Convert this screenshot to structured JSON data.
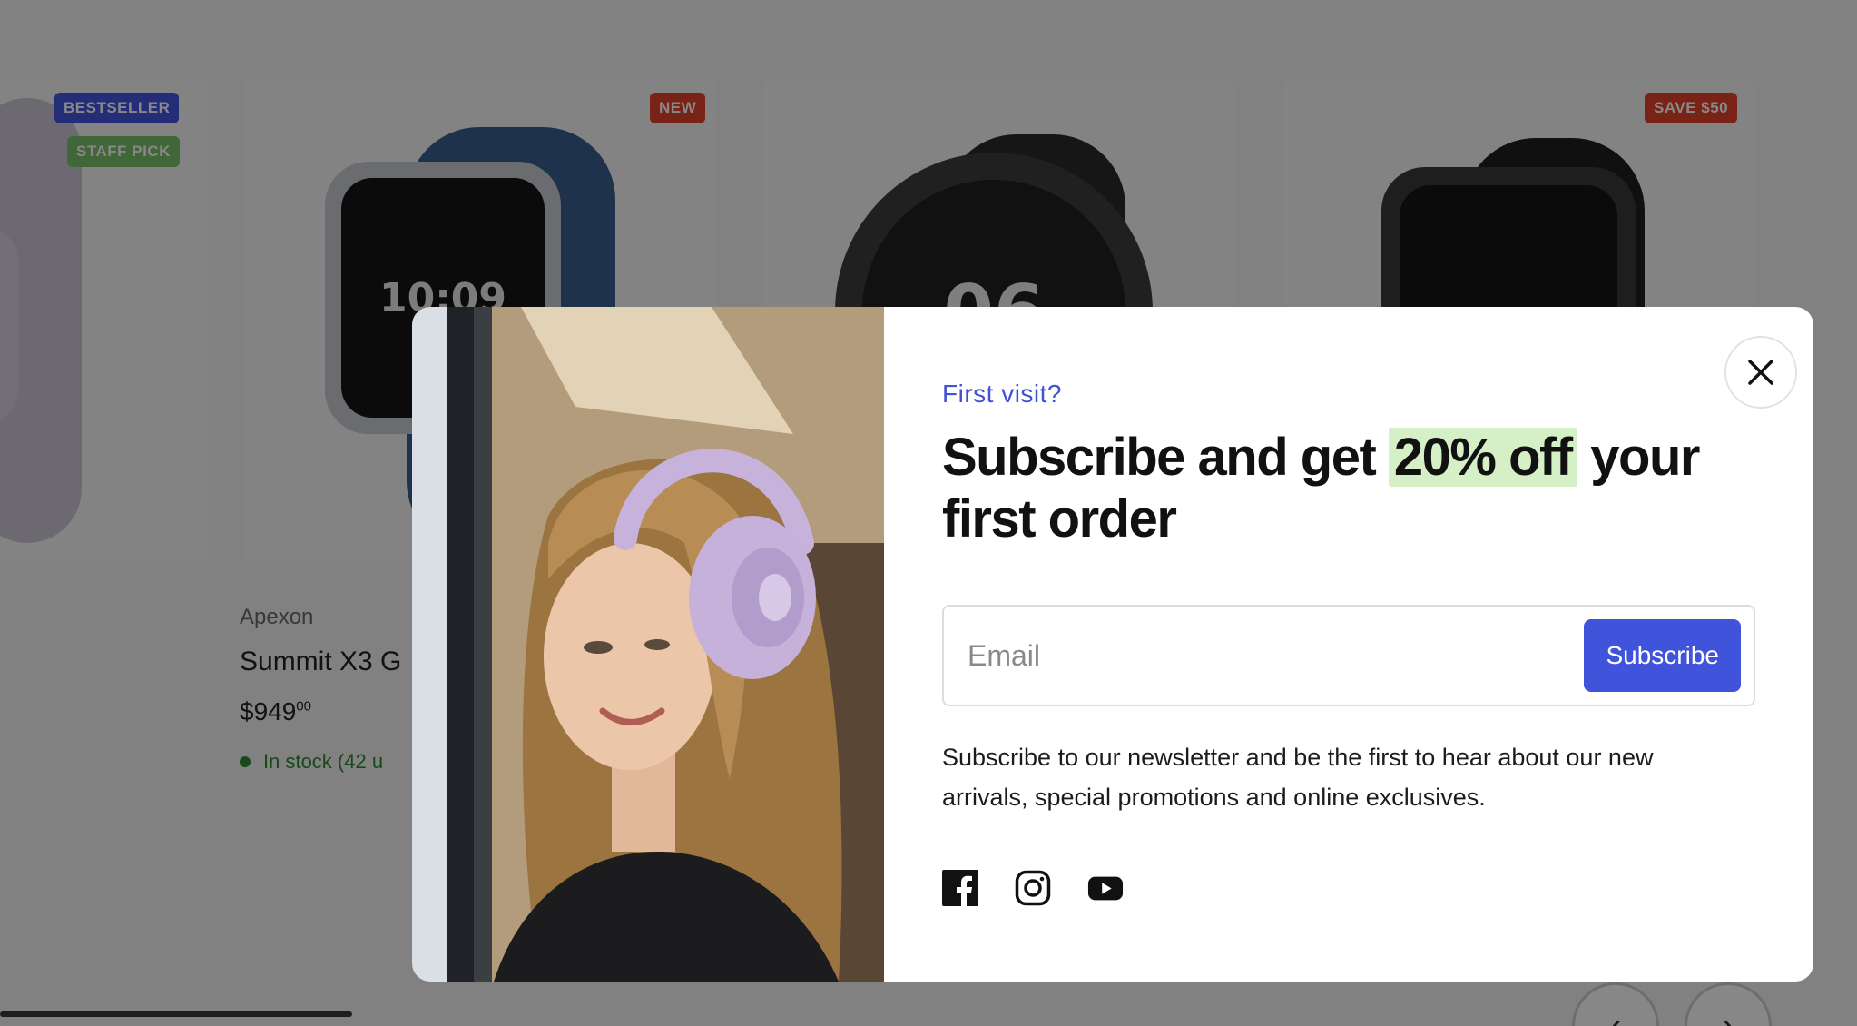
{
  "background": {
    "badges": {
      "card0": [
        "BESTSELLER",
        "STAFF PICK"
      ],
      "card1": [
        "NEW"
      ],
      "card3": [
        "SAVE $50"
      ]
    },
    "watch_faces": [
      "10:09",
      "06"
    ],
    "product": {
      "brand": "Apexon",
      "name": "Summit X3 G",
      "price": "$949",
      "price_cents": "00",
      "stock": "In stock (42 u"
    },
    "carousel": {
      "prev": "‹",
      "next": "›"
    }
  },
  "modal": {
    "eyebrow": "First visit?",
    "headline_before": "Subscribe and get ",
    "headline_highlight": "20% off",
    "headline_after": " your first order",
    "email_placeholder": "Email",
    "subscribe_label": "Subscribe",
    "description": "Subscribe to our newsletter and be the first to hear about our new arrivals, special promotions and online exclusives.",
    "socials": [
      "facebook-icon",
      "instagram-icon",
      "youtube-icon"
    ],
    "accent_color": "#3f53db",
    "highlight_color": "#d5f0c6"
  }
}
